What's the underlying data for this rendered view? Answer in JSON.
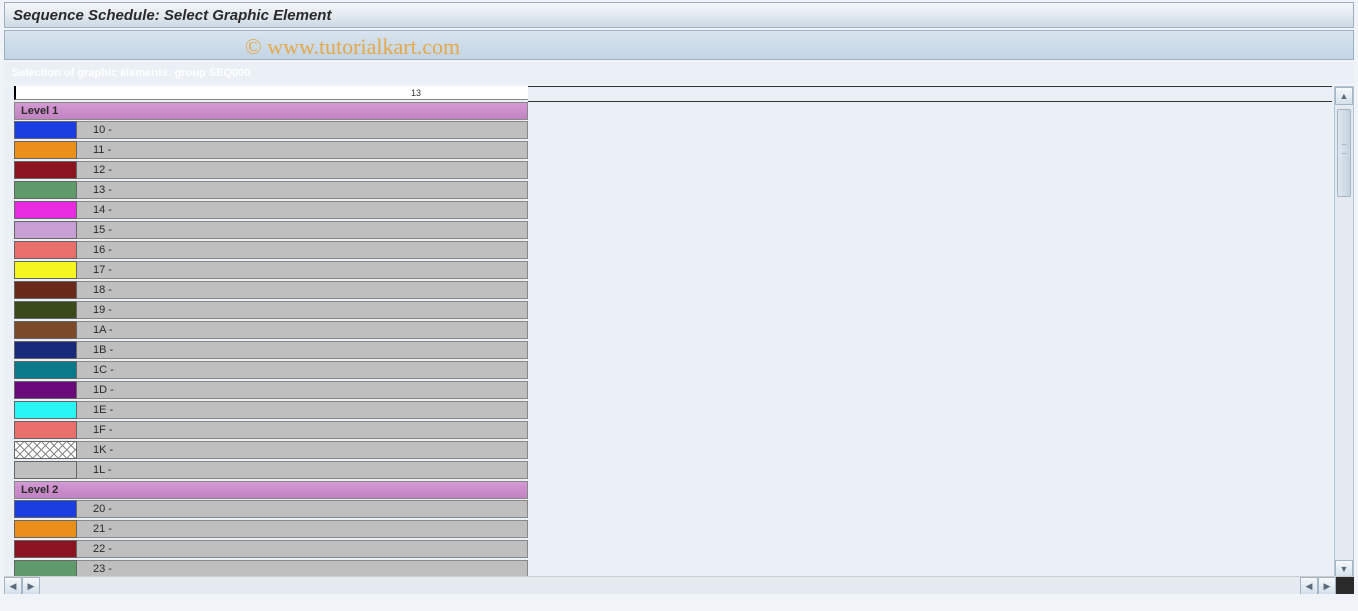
{
  "title": "Sequence Schedule: Select Graphic Element",
  "watermark": "© www.tutorialkart.com",
  "subtitle": "Selection of graphic elements: group SEQ000",
  "ruler": {
    "tick_label": "13",
    "tick_pos": 395
  },
  "levels": [
    {
      "name": "Level 1",
      "items": [
        {
          "code": "10 -",
          "color": "#1a3ee0"
        },
        {
          "code": "11 -",
          "color": "#e98f1a"
        },
        {
          "code": "12 -",
          "color": "#8a1520"
        },
        {
          "code": "13 -",
          "color": "#5f9a6a"
        },
        {
          "code": "14 -",
          "color": "#e82ae0"
        },
        {
          "code": "15 -",
          "color": "#c79fd4"
        },
        {
          "code": "16 -",
          "color": "#e86f6a"
        },
        {
          "code": "17 -",
          "color": "#f5f520"
        },
        {
          "code": "18 -",
          "color": "#6a2a1a"
        },
        {
          "code": "19 -",
          "color": "#3a4a1a"
        },
        {
          "code": "1A -",
          "color": "#7a4a2a"
        },
        {
          "code": "1B -",
          "color": "#1a2a7a"
        },
        {
          "code": "1C -",
          "color": "#0a7a8a"
        },
        {
          "code": "1D -",
          "color": "#6a0a7a"
        },
        {
          "code": "1E -",
          "color": "#2af5f5"
        },
        {
          "code": "1F -",
          "color": "#e86f6a"
        },
        {
          "code": "1K -",
          "hatch": true
        },
        {
          "code": "1L -",
          "color": "#bfbfbf"
        }
      ]
    },
    {
      "name": "Level 2",
      "items": [
        {
          "code": "20 -",
          "color": "#1a3ee0"
        },
        {
          "code": "21 -",
          "color": "#e98f1a"
        },
        {
          "code": "22 -",
          "color": "#8a1520"
        },
        {
          "code": "23 -",
          "color": "#5f9a6a"
        }
      ]
    }
  ]
}
